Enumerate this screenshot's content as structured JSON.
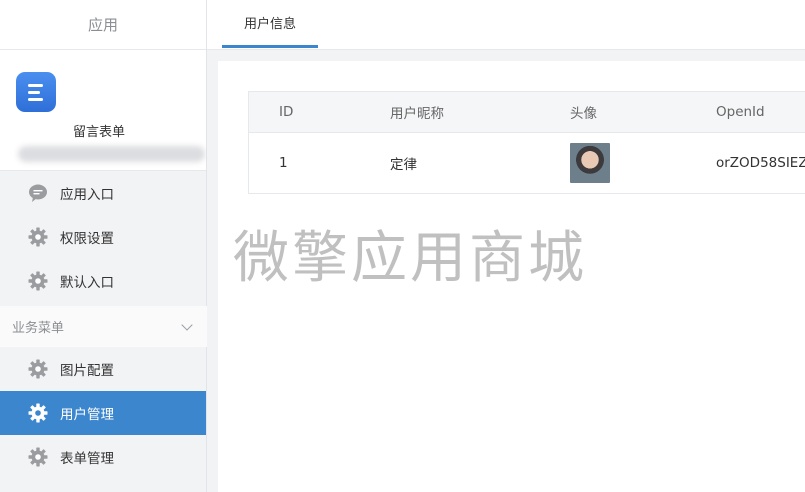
{
  "sidebar": {
    "header": "应用",
    "app_name": "留言表单",
    "items": [
      {
        "label": "应用入口",
        "icon": "chat-icon"
      },
      {
        "label": "权限设置",
        "icon": "gear-icon"
      },
      {
        "label": "默认入口",
        "icon": "gear-icon"
      }
    ],
    "section": "业务菜单",
    "section_items": [
      {
        "label": "图片配置",
        "icon": "gear-icon"
      },
      {
        "label": "用户管理",
        "icon": "gear-icon",
        "active": true
      },
      {
        "label": "表单管理",
        "icon": "gear-icon"
      }
    ]
  },
  "tabs": [
    {
      "label": "用户信息",
      "active": true
    }
  ],
  "table": {
    "headers": [
      "ID",
      "用户昵称",
      "头像",
      "OpenId"
    ],
    "rows": [
      {
        "id": "1",
        "nickname": "定律",
        "openid": "orZOD58SIEZ"
      }
    ]
  },
  "watermark": "微擎应用商城",
  "colors": {
    "accent": "#3b86cc",
    "sidebar_bg": "#f2f3f5"
  }
}
